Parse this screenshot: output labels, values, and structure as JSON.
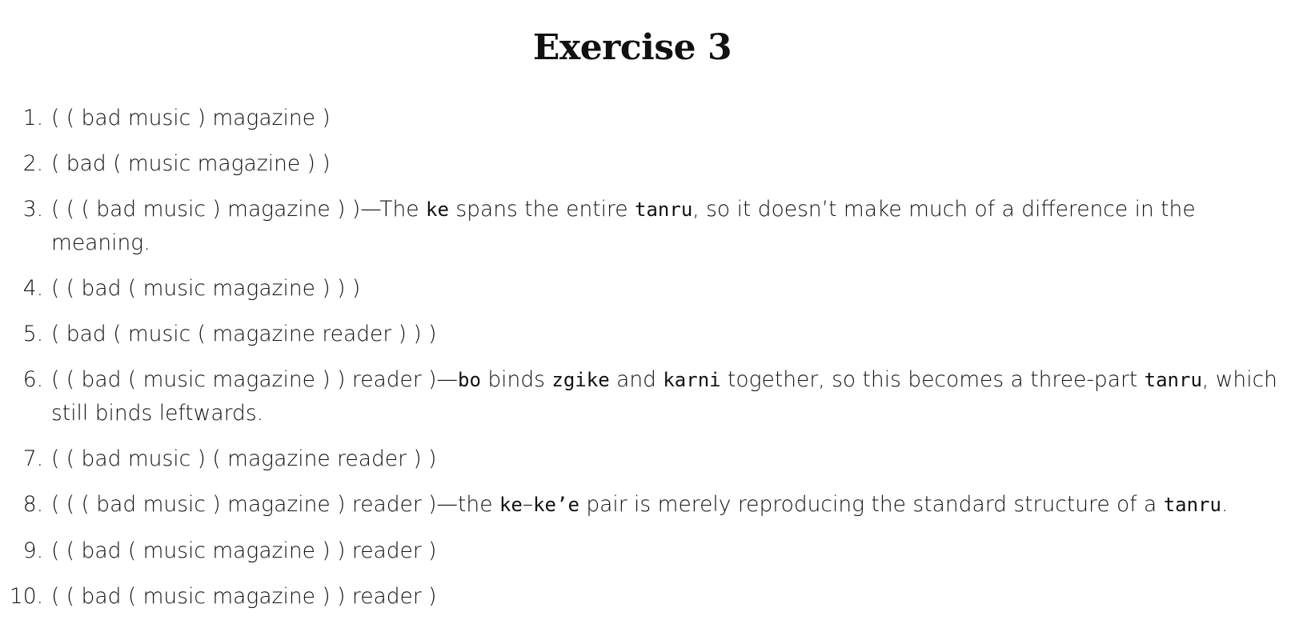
{
  "title": "Exercise 3",
  "items": [
    {
      "number": "1.",
      "parts": [
        {
          "t": "( ( bad music ) magazine )"
        }
      ]
    },
    {
      "number": "2.",
      "parts": [
        {
          "t": "( bad ( music magazine ) )"
        }
      ]
    },
    {
      "number": "3.",
      "parts": [
        {
          "t": "( ( ( bad music ) magazine ) )—The "
        },
        {
          "t": "ke",
          "code": true
        },
        {
          "t": " spans the entire "
        },
        {
          "t": "tanru",
          "code": true
        },
        {
          "t": ", so it doesn’t make much of a difference in the meaning."
        }
      ]
    },
    {
      "number": "4.",
      "parts": [
        {
          "t": "( ( bad ( music magazine ) ) )"
        }
      ]
    },
    {
      "number": "5.",
      "parts": [
        {
          "t": "( bad ( music ( magazine reader ) ) )"
        }
      ]
    },
    {
      "number": "6.",
      "parts": [
        {
          "t": "( ( bad ( music magazine ) ) reader )—"
        },
        {
          "t": "bo",
          "code": true
        },
        {
          "t": " binds "
        },
        {
          "t": "zgike",
          "code": true
        },
        {
          "t": " and "
        },
        {
          "t": "karni",
          "code": true
        },
        {
          "t": " together, so this becomes a three-part "
        },
        {
          "t": "tanru",
          "code": true
        },
        {
          "t": ", which still binds leftwards."
        }
      ]
    },
    {
      "number": "7.",
      "parts": [
        {
          "t": "( ( bad music ) ( magazine reader ) )"
        }
      ]
    },
    {
      "number": "8.",
      "parts": [
        {
          "t": "( ( ( bad music ) magazine ) reader )—the "
        },
        {
          "t": "ke",
          "code": true
        },
        {
          "t": "–"
        },
        {
          "t": "ke’e",
          "code": true
        },
        {
          "t": " pair is merely reproducing the standard structure of a "
        },
        {
          "t": "tanru",
          "code": true
        },
        {
          "t": "."
        }
      ]
    },
    {
      "number": "9.",
      "parts": [
        {
          "t": "( ( bad ( music magazine ) ) reader )"
        }
      ]
    },
    {
      "number": "10.",
      "parts": [
        {
          "t": "( ( bad ( music magazine ) ) reader )"
        }
      ]
    }
  ]
}
